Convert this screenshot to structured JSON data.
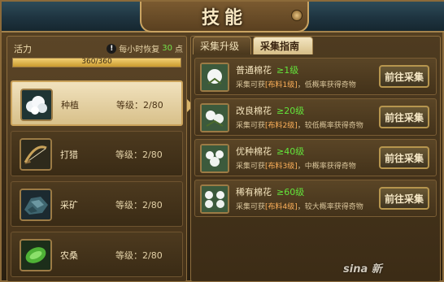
{
  "window": {
    "title": "技能"
  },
  "energy": {
    "label": "活力",
    "hint_prefix": "每小时恢复",
    "hint_value": "30",
    "hint_suffix": "点",
    "value_text": "360/360",
    "fill_fraction": 1.0
  },
  "skills": [
    {
      "name": "种植",
      "level_label": "等级：",
      "level": "2/80",
      "icon": "cotton-seed-icon",
      "active": true
    },
    {
      "name": "打猎",
      "level_label": "等级：",
      "level": "2/80",
      "icon": "hunting-bow-icon",
      "active": false
    },
    {
      "name": "采矿",
      "level_label": "等级：",
      "level": "2/80",
      "icon": "ore-icon",
      "active": false
    },
    {
      "name": "农桑",
      "level_label": "等级：",
      "level": "2/80",
      "icon": "leaf-icon",
      "active": false
    }
  ],
  "tabs": [
    {
      "label": "采集升级",
      "active": false
    },
    {
      "label": "采集指南",
      "active": true
    }
  ],
  "gather_items": [
    {
      "name": "普通棉花",
      "req": "≥1级",
      "desc_prefix": "采集可获",
      "material": "[布料1级]",
      "desc_suffix": "，低概率获得奇物",
      "button": "前往采集"
    },
    {
      "name": "改良棉花",
      "req": "≥20级",
      "desc_prefix": "采集可获",
      "material": "[布料2级]",
      "desc_suffix": "，较低概率获得奇物",
      "button": "前往采集"
    },
    {
      "name": "优种棉花",
      "req": "≥40级",
      "desc_prefix": "采集可获",
      "material": "[布料3级]",
      "desc_suffix": "，中概率获得奇物",
      "button": "前往采集"
    },
    {
      "name": "稀有棉花",
      "req": "≥60级",
      "desc_prefix": "采集可获",
      "material": "[布料4级]",
      "desc_suffix": "，较大概率获得奇物",
      "button": "前往采集"
    }
  ],
  "watermark": "sina 新"
}
